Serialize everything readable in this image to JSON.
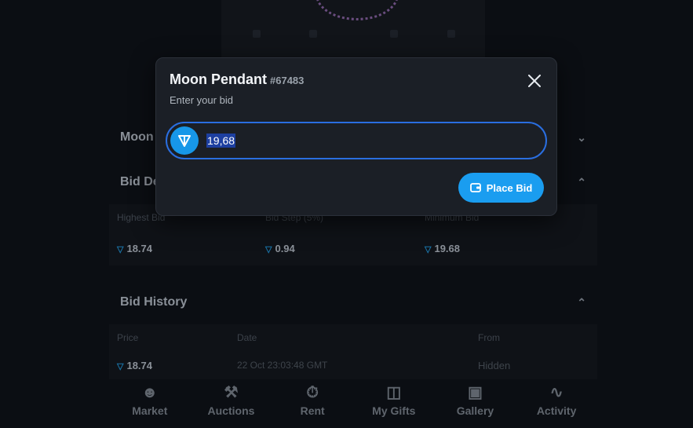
{
  "background": {
    "sections": [
      {
        "label": "Moon",
        "chevron": "chevron-down-icon"
      },
      {
        "label": "Bid De",
        "chevron": "chevron-up-icon"
      },
      {
        "label": "Bid History",
        "chevron": "chevron-up-icon"
      }
    ],
    "bid_details": {
      "headers": [
        "Highest Bid",
        "Bid Step (5%)",
        "Minimum Bid"
      ],
      "values": [
        "18.74",
        "0.94",
        "19.68"
      ]
    },
    "bid_history": {
      "headers": [
        "Price",
        "Date",
        "From"
      ],
      "rows": [
        {
          "price": "18.74",
          "date": "22 Oct 23:03:48 GMT",
          "from": "Hidden"
        }
      ]
    },
    "nav": [
      {
        "label": "Market",
        "icon": "market-icon"
      },
      {
        "label": "Auctions",
        "icon": "gavel-icon"
      },
      {
        "label": "Rent",
        "icon": "stopwatch-icon"
      },
      {
        "label": "My Gifts",
        "icon": "gift-icon"
      },
      {
        "label": "Gallery",
        "icon": "store-icon"
      },
      {
        "label": "Activity",
        "icon": "activity-icon"
      }
    ]
  },
  "modal": {
    "title": "Moon Pendant",
    "item_id": "#67483",
    "subtitle": "Enter your bid",
    "bid_value": "19,68",
    "place_bid_label": "Place Bid",
    "accent": "#1a9df0",
    "input_border": "#2a6ee0"
  }
}
